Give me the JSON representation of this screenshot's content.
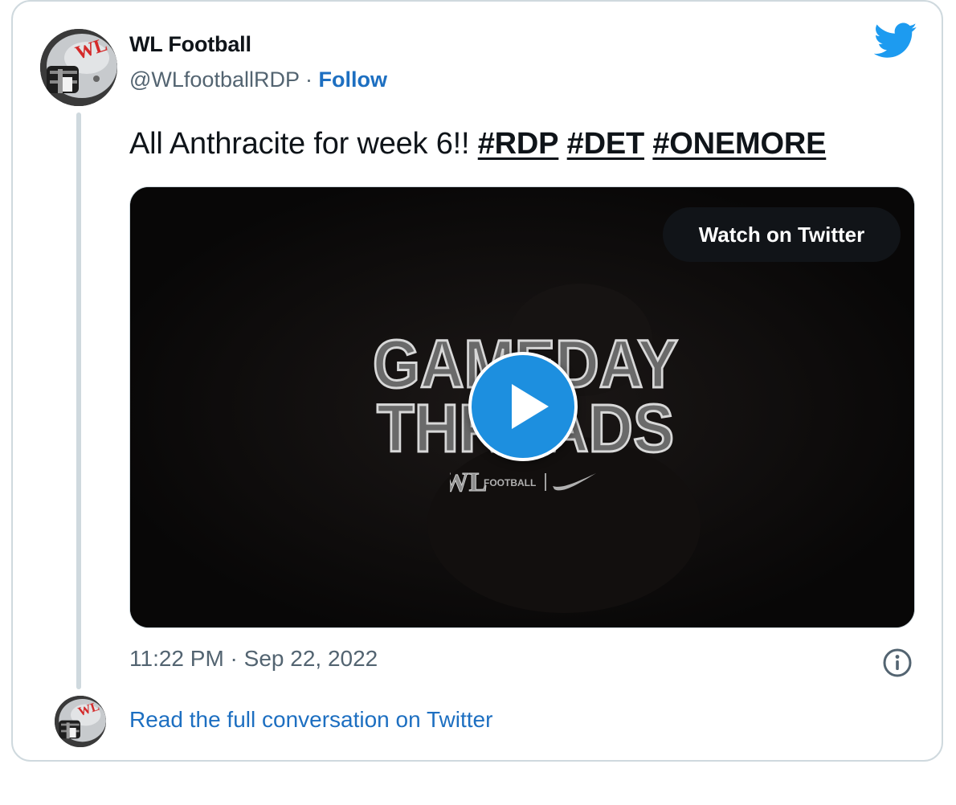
{
  "author": {
    "name": "WL Football",
    "handle": "@WLfootballRDP",
    "separator": " · ",
    "follow_label": "Follow"
  },
  "tweet": {
    "text": "All Anthracite for week 6!!",
    "hashtags": [
      "#RDP",
      "#DET",
      "#ONEMORE"
    ]
  },
  "video": {
    "watch_label": "Watch on Twitter",
    "overlay_title_line1": "GAMEDAY",
    "overlay_title_line2": "THREADS",
    "brand_logo_text": "WL",
    "brand_text": "FOOTBALL"
  },
  "meta": {
    "timestamp": "11:22 PM · Sep 22, 2022"
  },
  "footer": {
    "read_label": "Read the full conversation on Twitter"
  },
  "avatar_logo_text": "WL",
  "icons": {
    "brand": "twitter-bird-icon",
    "info": "info-icon",
    "play": "play-icon"
  },
  "colors": {
    "link": "#1d6fc1",
    "twitter_blue": "#1d9bf0",
    "border": "#cfd9de",
    "secondary_text": "#536471",
    "play_button": "#1d8fdf"
  }
}
